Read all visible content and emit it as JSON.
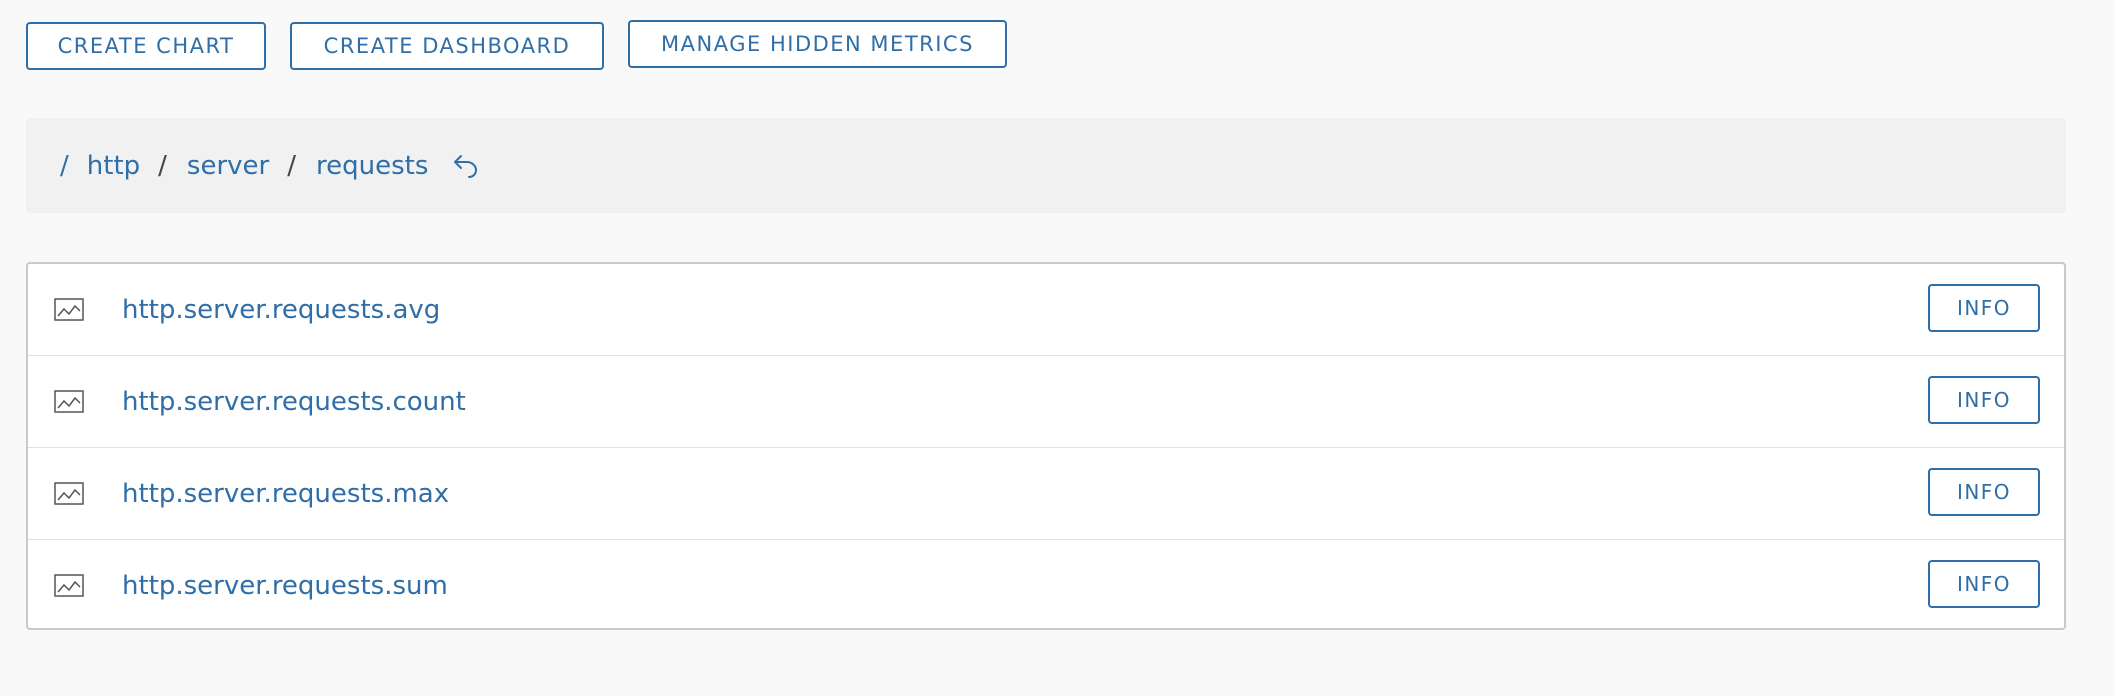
{
  "toolbar": {
    "create_chart": "CREATE CHART",
    "create_dashboard": "CREATE DASHBOARD",
    "manage_hidden_metrics": "MANAGE HIDDEN METRICS"
  },
  "breadcrumb": {
    "root_sep": "/",
    "items": [
      "http",
      "server",
      "requests"
    ],
    "sep": "/",
    "back_icon": "undo-arrow-icon"
  },
  "metrics": {
    "row_icon": "line-chart-icon",
    "info_label": "INFO",
    "items": [
      {
        "name": "http.server.requests.avg"
      },
      {
        "name": "http.server.requests.count"
      },
      {
        "name": "http.server.requests.max"
      },
      {
        "name": "http.server.requests.sum"
      }
    ]
  },
  "colors": {
    "accent": "#2f6ea7",
    "background": "#f9f9f9",
    "breadcrumb_bg": "#f1f1f1",
    "border": "#c9c9c9"
  }
}
